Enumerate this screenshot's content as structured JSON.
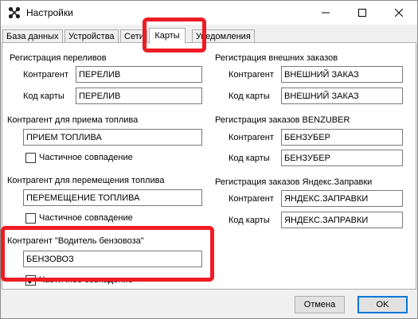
{
  "window": {
    "title": "Настройки"
  },
  "tabs": [
    "База данных",
    "Устройства",
    "Сети",
    "Карты",
    "Уведомления"
  ],
  "groups": {
    "overflow": {
      "title": "Регистрация переливов",
      "counterparty_label": "Контрагент",
      "counterparty_value": "ПЕРЕЛИВ",
      "card_label": "Код карты",
      "card_value": "ПЕРЕЛИВ"
    },
    "fuel_receipt": {
      "title": "Контрагент для приема топлива",
      "value": "ПРИЕМ ТОПЛИВА",
      "partial_label": "Частичное совпадение",
      "partial_checked": false
    },
    "fuel_transfer": {
      "title": "Контрагент для перемещения топлива",
      "value": "ПЕРЕМЕЩЕНИЕ ТОПЛИВА",
      "partial_label": "Частичное совпадение",
      "partial_checked": false
    },
    "fuel_truck_driver": {
      "title": "Контрагент \"Водитель бензовоза\"",
      "value": "БЕНЗОВОЗ",
      "partial_label": "Частичное совпадение",
      "partial_checked": true
    },
    "external_orders": {
      "title": "Регистрация внешних заказов",
      "counterparty_label": "Контрагент",
      "counterparty_value": "ВНЕШНИЙ ЗАКАЗ",
      "card_label": "Код карты",
      "card_value": "ВНЕШНИЙ ЗАКАЗ"
    },
    "benzuber": {
      "title": "Регистрация заказов BENZUBER",
      "counterparty_label": "Контрагент",
      "counterparty_value": "БЕНЗУБЕР",
      "card_label": "Код карты",
      "card_value": "БЕНЗУБЕР"
    },
    "yandex": {
      "title": "Регистрация заказов Яндекс.Заправки",
      "counterparty_label": "Контрагент",
      "counterparty_value": "ЯНДЕКС.ЗАПРАВКИ",
      "card_label": "Код карты",
      "card_value": "ЯНДЕКС.ЗАПРАВКИ"
    }
  },
  "footer": {
    "cancel_label": "Отмена",
    "ok_label": "OK"
  },
  "colors": {
    "highlight": "#ee1c25",
    "panel_bg": "#ffffff",
    "window_bg": "#f0f0f0",
    "checkmark": "#000000"
  },
  "icons": {
    "app": "app-logo-icon",
    "minimize": "minimize-icon",
    "maximize": "maximize-icon",
    "close": "close-icon",
    "check": "checkmark-icon"
  }
}
